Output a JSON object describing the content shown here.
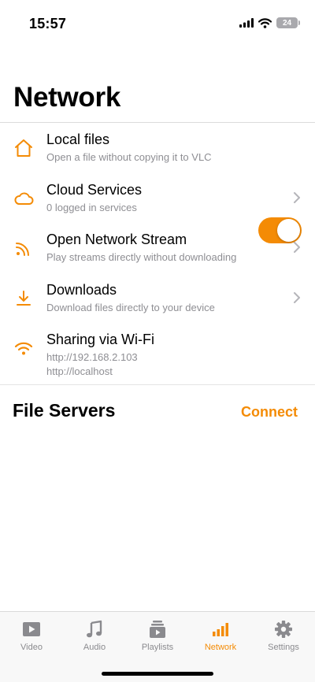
{
  "status_bar": {
    "time": "15:57",
    "battery": "24"
  },
  "page": {
    "title": "Network"
  },
  "menu": {
    "local_files": {
      "title": "Local files",
      "subtitle": "Open a file without copying it to VLC",
      "icon": "house-icon"
    },
    "cloud_services": {
      "title": "Cloud Services",
      "subtitle": "0 logged in services",
      "icon": "cloud-icon"
    },
    "network_stream": {
      "title": "Open Network Stream",
      "subtitle": "Play streams directly without downloading",
      "icon": "rss-feed-icon"
    },
    "downloads": {
      "title": "Downloads",
      "subtitle": "Download files directly to your device",
      "icon": "download-icon"
    },
    "wifi_sharing": {
      "title": "Sharing via Wi-Fi",
      "address_1": "http://192.168.2.103",
      "address_2": "http://localhost",
      "icon": "wifi-icon",
      "enabled": true
    }
  },
  "file_servers": {
    "title": "File Servers",
    "connect_label": "Connect"
  },
  "tab_bar": {
    "active": "Network",
    "tabs": [
      {
        "label": "Video",
        "icon": "video-icon"
      },
      {
        "label": "Audio",
        "icon": "music-note-icon"
      },
      {
        "label": "Playlists",
        "icon": "playlist-icon"
      },
      {
        "label": "Network",
        "icon": "signal-bars-icon"
      },
      {
        "label": "Settings",
        "icon": "gear-icon"
      }
    ]
  },
  "colors": {
    "accent": "#f48b05",
    "secondary_text": "#8e8e93",
    "inactive_tab": "#8a8a8e"
  }
}
